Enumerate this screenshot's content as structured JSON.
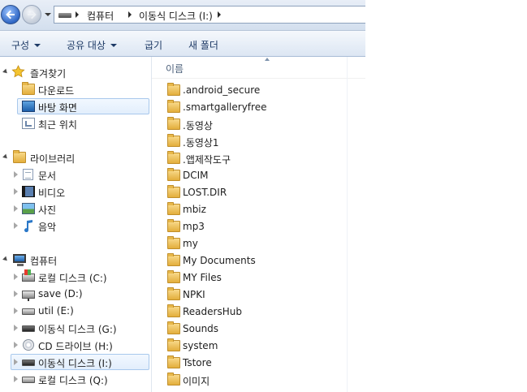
{
  "address": {
    "crumbs": [
      "컴퓨터",
      "이동식 디스크 (I:)"
    ]
  },
  "toolbar": {
    "organize": "구성",
    "share": "공유 대상",
    "burn": "굽기",
    "new_folder": "새 폴더"
  },
  "nav": {
    "favorites": {
      "label": "즐겨찾기",
      "items": [
        "다운로드",
        "바탕 화면",
        "최근 위치"
      ]
    },
    "libraries": {
      "label": "라이브러리",
      "items": [
        "문서",
        "비디오",
        "사진",
        "음악"
      ]
    },
    "computer": {
      "label": "컴퓨터",
      "items": [
        "로컬 디스크 (C:)",
        "save (D:)",
        "util (E:)",
        "이동식 디스크 (G:)",
        "CD 드라이브 (H:)",
        "이동식 디스크 (I:)",
        "로컬 디스크 (Q:)"
      ]
    }
  },
  "list": {
    "column_name": "이름",
    "items": [
      ".android_secure",
      ".smartgalleryfree",
      ".동영상",
      ".동영상1",
      ".앱제작도구",
      "DCIM",
      "LOST.DIR",
      "mbiz",
      "mp3",
      "my",
      "My Documents",
      "MY Files",
      "NPKI",
      "ReadersHub",
      "Sounds",
      "system",
      "Tstore",
      "이미지"
    ]
  }
}
